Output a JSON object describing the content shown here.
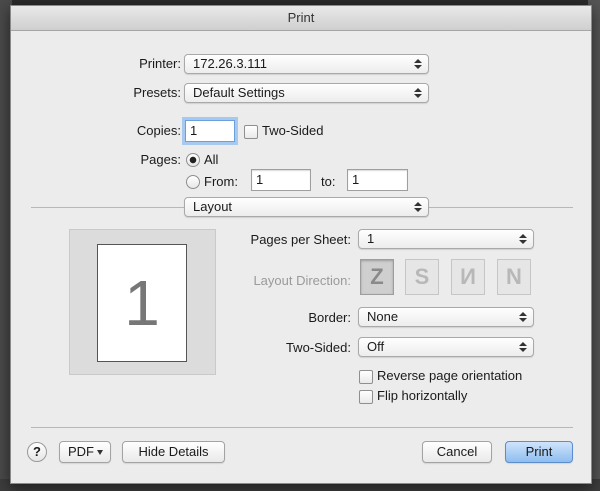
{
  "window": {
    "title": "Print"
  },
  "printer": {
    "label": "Printer:",
    "value": "172.26.3.111"
  },
  "presets": {
    "label": "Presets:",
    "value": "Default Settings"
  },
  "copies": {
    "label": "Copies:",
    "value": "1",
    "two_sided_label": "Two-Sided",
    "two_sided_checked": false
  },
  "pages": {
    "label": "Pages:",
    "all_label": "All",
    "from_label": "From:",
    "from_value": "1",
    "to_label": "to:",
    "to_value": "1",
    "selected": "All"
  },
  "section_popup": {
    "value": "Layout"
  },
  "preview": {
    "page_number": "1"
  },
  "layout": {
    "pages_per_sheet_label": "Pages per Sheet:",
    "pages_per_sheet_value": "1",
    "layout_direction_label": "Layout Direction:",
    "direction_icons": [
      "layout-z-icon",
      "layout-s-icon",
      "layout-n-reverse-icon",
      "layout-n-icon"
    ],
    "border_label": "Border:",
    "border_value": "None",
    "two_sided_label": "Two-Sided:",
    "two_sided_value": "Off",
    "reverse_label": "Reverse page orientation",
    "reverse_checked": false,
    "flip_label": "Flip horizontally",
    "flip_checked": false
  },
  "footer": {
    "help_label": "?",
    "pdf_label": "PDF",
    "hide_details_label": "Hide Details",
    "cancel_label": "Cancel",
    "print_label": "Print"
  },
  "colors": {
    "dialog_bg": "#ececec",
    "default_button": "#8fbdf0",
    "focus_ring": "#a7c8ef"
  }
}
